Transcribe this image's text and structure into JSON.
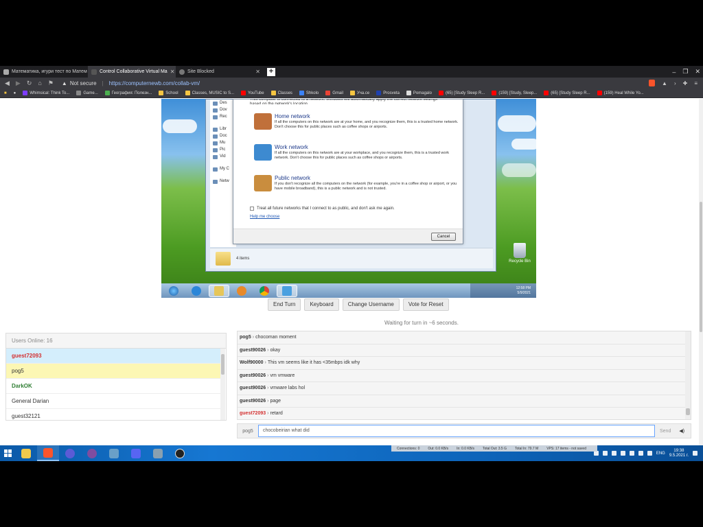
{
  "browser": {
    "tabs": [
      {
        "label": "Математика, игури тест по Матем",
        "active": false
      },
      {
        "label": "Control Collaborative Virtual Ma",
        "active": true
      },
      {
        "label": "Site Blocked",
        "active": false
      }
    ],
    "secure_label": "Not secure",
    "url": "https://computernewb.com/collab-vm/"
  },
  "bookmarks": [
    {
      "label": "Whimsical: Think To...",
      "color": "#7d3cff"
    },
    {
      "label": "Game...",
      "color": "#888"
    },
    {
      "label": "География: Полезн...",
      "color": "#4caf50"
    },
    {
      "label": "School",
      "color": "#f5c542"
    },
    {
      "label": "Classes, MUSIC to S...",
      "color": "#f5c542"
    },
    {
      "label": "YouTube",
      "color": "#ff0000"
    },
    {
      "label": "Classes",
      "color": "#f5c542"
    },
    {
      "label": "Shkolo",
      "color": "#3b82f6"
    },
    {
      "label": "Gmail",
      "color": "#ea4335"
    },
    {
      "label": "Уча.се",
      "color": "#f5c542"
    },
    {
      "label": "Prosveta",
      "color": "#1e40af"
    },
    {
      "label": "Pomagalo",
      "color": "#ddd"
    },
    {
      "label": "(65) [Study Sleep R...",
      "color": "#ff0000"
    },
    {
      "label": "(159) [Study, Sleep...",
      "color": "#ff0000"
    },
    {
      "label": "(65) [Study Sleep R...",
      "color": "#ff0000"
    },
    {
      "label": "(159) Heal While Yo...",
      "color": "#ff0000"
    }
  ],
  "vm": {
    "explorer": {
      "sidebar": [
        "Des",
        "Dov",
        "Rec",
        "Libr",
        "Doc",
        "Mu",
        "Pic",
        "Vid",
        "My C",
        "Netw"
      ],
      "status": "4 items"
    },
    "dialog": {
      "intro": "This computer is connected to a network. Windows will automatically apply the correct network settings based on the network's location.",
      "options": [
        {
          "title": "Home network",
          "desc": "If all the computers on this network are at your home, and you recognize them, this is a trusted home network. Don't choose this for public places such as coffee shops or airports.",
          "color": "#c0703a"
        },
        {
          "title": "Work network",
          "desc": "If all the computers on this network are at your workplace, and you recognize them, this is a trusted work network. Don't choose this for public places such as coffee shops or airports.",
          "color": "#3d8ad0"
        },
        {
          "title": "Public network",
          "desc": "If you don't recognize all the computers on the network (for example, you're in a coffee shop or airport, or you have mobile broadband), this is a public network and is not trusted.",
          "color": "#c98d3e"
        }
      ],
      "checkbox": "Treat all future networks that I connect to as public, and don't ask me again.",
      "help": "Help me choose",
      "cancel": "Cancel"
    },
    "recycle_bin": "Recycle Bin",
    "clock": {
      "time": "12:58 PM",
      "date": "5/9/2021"
    }
  },
  "controls": {
    "buttons": [
      "End Turn",
      "Keyboard",
      "Change Username",
      "Vote for Reset"
    ],
    "turn_status": "Waiting for turn in ~6 seconds."
  },
  "users": {
    "header": "Users Online: 16",
    "list": [
      {
        "name": "guest72093",
        "color": "#d32f2f",
        "bg": "#d4eefc",
        "bold": true
      },
      {
        "name": "pog5",
        "color": "#333",
        "bg": "#fcf7b4",
        "bold": false
      },
      {
        "name": "DarkOK",
        "color": "#2e7d32",
        "bg": "#fff",
        "bold": true
      },
      {
        "name": "General Darian",
        "color": "#333",
        "bg": "#fff",
        "bold": false
      },
      {
        "name": "guest32121",
        "color": "#333",
        "bg": "#fff",
        "bold": false
      }
    ]
  },
  "chat": {
    "messages": [
      {
        "user": "pog5",
        "text": "chocoman moment",
        "color": "#333"
      },
      {
        "user": "guest90026",
        "text": "okay",
        "color": "#333"
      },
      {
        "user": "Wolf90000",
        "text": "This vm seems like it has <35mbps idk why",
        "color": "#333"
      },
      {
        "user": "guest90026",
        "text": "vm vmware",
        "color": "#333"
      },
      {
        "user": "guest90026",
        "text": "vmware labs hol",
        "color": "#333"
      },
      {
        "user": "guest90026",
        "text": "page",
        "color": "#333"
      },
      {
        "user": "guest72093",
        "text": "retard",
        "color": "#d32f2f"
      }
    ],
    "username": "pog5",
    "input_value": "chocobeirian what did",
    "send_label": "Send"
  },
  "taskbar": {
    "netstats": [
      "Connections: 0",
      "Out: 0.0 KB/s",
      "In: 0.0 KB/s",
      "Total Out: 3.5 G",
      "Total In: 79.7 M",
      "VPS: 17 items - not saved"
    ],
    "lang": "ENG",
    "time": "19:38",
    "date": "9.5.2021 г."
  }
}
